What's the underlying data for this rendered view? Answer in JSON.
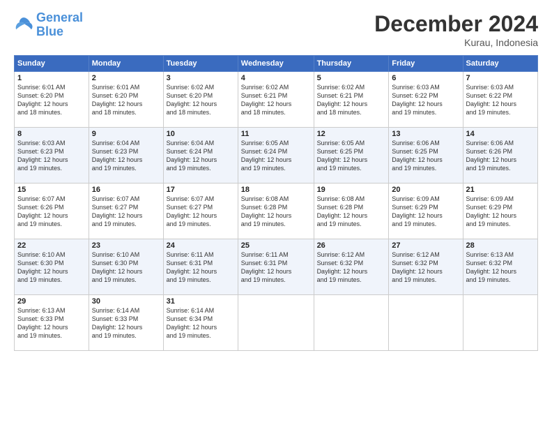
{
  "logo": {
    "line1": "General",
    "line2": "Blue"
  },
  "title": "December 2024",
  "subtitle": "Kurau, Indonesia",
  "days_header": [
    "Sunday",
    "Monday",
    "Tuesday",
    "Wednesday",
    "Thursday",
    "Friday",
    "Saturday"
  ],
  "weeks": [
    [
      {
        "day": "1",
        "info": "Sunrise: 6:01 AM\nSunset: 6:20 PM\nDaylight: 12 hours\nand 18 minutes."
      },
      {
        "day": "2",
        "info": "Sunrise: 6:01 AM\nSunset: 6:20 PM\nDaylight: 12 hours\nand 18 minutes."
      },
      {
        "day": "3",
        "info": "Sunrise: 6:02 AM\nSunset: 6:20 PM\nDaylight: 12 hours\nand 18 minutes."
      },
      {
        "day": "4",
        "info": "Sunrise: 6:02 AM\nSunset: 6:21 PM\nDaylight: 12 hours\nand 18 minutes."
      },
      {
        "day": "5",
        "info": "Sunrise: 6:02 AM\nSunset: 6:21 PM\nDaylight: 12 hours\nand 18 minutes."
      },
      {
        "day": "6",
        "info": "Sunrise: 6:03 AM\nSunset: 6:22 PM\nDaylight: 12 hours\nand 19 minutes."
      },
      {
        "day": "7",
        "info": "Sunrise: 6:03 AM\nSunset: 6:22 PM\nDaylight: 12 hours\nand 19 minutes."
      }
    ],
    [
      {
        "day": "8",
        "info": "Sunrise: 6:03 AM\nSunset: 6:23 PM\nDaylight: 12 hours\nand 19 minutes."
      },
      {
        "day": "9",
        "info": "Sunrise: 6:04 AM\nSunset: 6:23 PM\nDaylight: 12 hours\nand 19 minutes."
      },
      {
        "day": "10",
        "info": "Sunrise: 6:04 AM\nSunset: 6:24 PM\nDaylight: 12 hours\nand 19 minutes."
      },
      {
        "day": "11",
        "info": "Sunrise: 6:05 AM\nSunset: 6:24 PM\nDaylight: 12 hours\nand 19 minutes."
      },
      {
        "day": "12",
        "info": "Sunrise: 6:05 AM\nSunset: 6:25 PM\nDaylight: 12 hours\nand 19 minutes."
      },
      {
        "day": "13",
        "info": "Sunrise: 6:06 AM\nSunset: 6:25 PM\nDaylight: 12 hours\nand 19 minutes."
      },
      {
        "day": "14",
        "info": "Sunrise: 6:06 AM\nSunset: 6:26 PM\nDaylight: 12 hours\nand 19 minutes."
      }
    ],
    [
      {
        "day": "15",
        "info": "Sunrise: 6:07 AM\nSunset: 6:26 PM\nDaylight: 12 hours\nand 19 minutes."
      },
      {
        "day": "16",
        "info": "Sunrise: 6:07 AM\nSunset: 6:27 PM\nDaylight: 12 hours\nand 19 minutes."
      },
      {
        "day": "17",
        "info": "Sunrise: 6:07 AM\nSunset: 6:27 PM\nDaylight: 12 hours\nand 19 minutes."
      },
      {
        "day": "18",
        "info": "Sunrise: 6:08 AM\nSunset: 6:28 PM\nDaylight: 12 hours\nand 19 minutes."
      },
      {
        "day": "19",
        "info": "Sunrise: 6:08 AM\nSunset: 6:28 PM\nDaylight: 12 hours\nand 19 minutes."
      },
      {
        "day": "20",
        "info": "Sunrise: 6:09 AM\nSunset: 6:29 PM\nDaylight: 12 hours\nand 19 minutes."
      },
      {
        "day": "21",
        "info": "Sunrise: 6:09 AM\nSunset: 6:29 PM\nDaylight: 12 hours\nand 19 minutes."
      }
    ],
    [
      {
        "day": "22",
        "info": "Sunrise: 6:10 AM\nSunset: 6:30 PM\nDaylight: 12 hours\nand 19 minutes."
      },
      {
        "day": "23",
        "info": "Sunrise: 6:10 AM\nSunset: 6:30 PM\nDaylight: 12 hours\nand 19 minutes."
      },
      {
        "day": "24",
        "info": "Sunrise: 6:11 AM\nSunset: 6:31 PM\nDaylight: 12 hours\nand 19 minutes."
      },
      {
        "day": "25",
        "info": "Sunrise: 6:11 AM\nSunset: 6:31 PM\nDaylight: 12 hours\nand 19 minutes."
      },
      {
        "day": "26",
        "info": "Sunrise: 6:12 AM\nSunset: 6:32 PM\nDaylight: 12 hours\nand 19 minutes."
      },
      {
        "day": "27",
        "info": "Sunrise: 6:12 AM\nSunset: 6:32 PM\nDaylight: 12 hours\nand 19 minutes."
      },
      {
        "day": "28",
        "info": "Sunrise: 6:13 AM\nSunset: 6:32 PM\nDaylight: 12 hours\nand 19 minutes."
      }
    ],
    [
      {
        "day": "29",
        "info": "Sunrise: 6:13 AM\nSunset: 6:33 PM\nDaylight: 12 hours\nand 19 minutes."
      },
      {
        "day": "30",
        "info": "Sunrise: 6:14 AM\nSunset: 6:33 PM\nDaylight: 12 hours\nand 19 minutes."
      },
      {
        "day": "31",
        "info": "Sunrise: 6:14 AM\nSunset: 6:34 PM\nDaylight: 12 hours\nand 19 minutes."
      },
      null,
      null,
      null,
      null
    ]
  ]
}
